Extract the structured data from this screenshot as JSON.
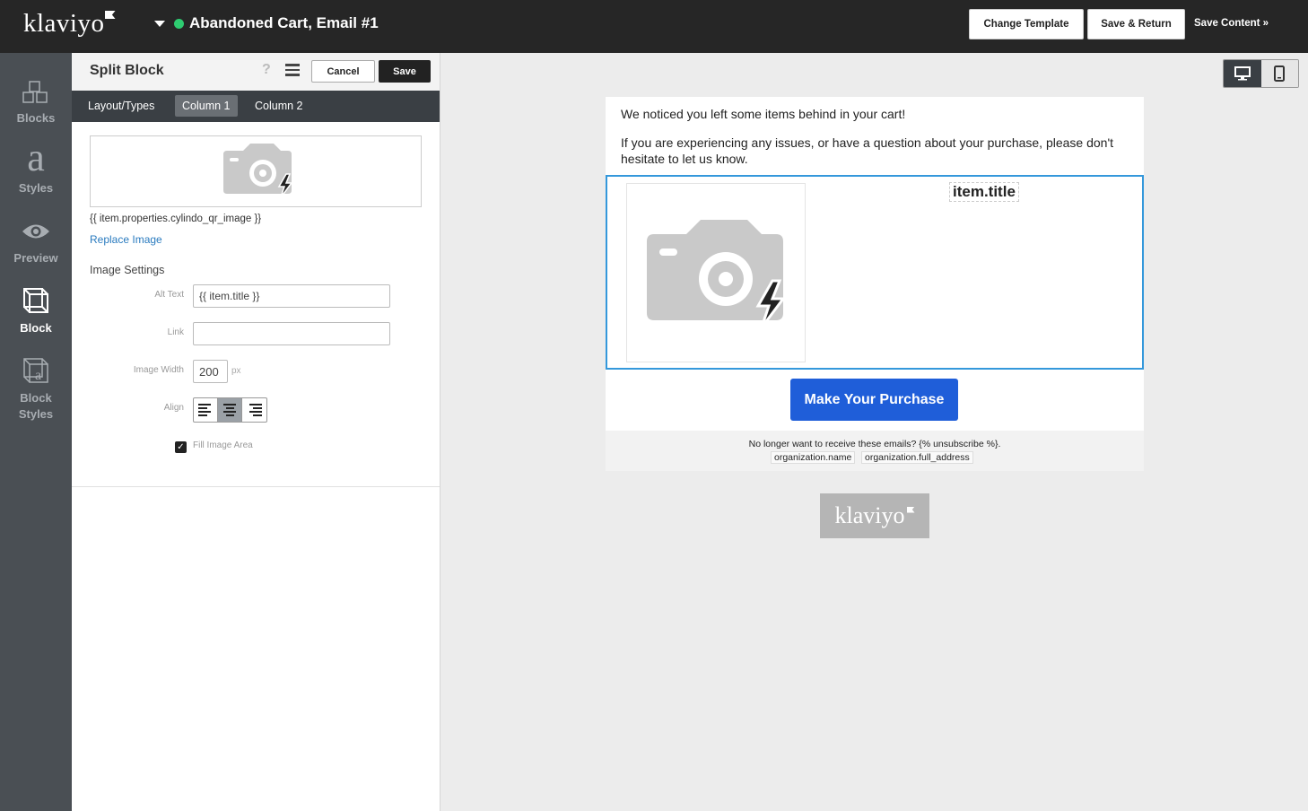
{
  "topbar": {
    "logo": "klaviyo",
    "flow_title": "Abandoned Cart, Email #1",
    "status_color": "#2ecc71",
    "change_template": "Change Template",
    "save_return": "Save & Return",
    "save_content": "Save Content »"
  },
  "rail": {
    "items": [
      {
        "label": "Blocks",
        "icon": "blocks-icon"
      },
      {
        "label": "Styles",
        "icon": "styles-icon"
      },
      {
        "label": "Preview",
        "icon": "eye-icon"
      },
      {
        "label": "Block",
        "icon": "cube-icon",
        "active": true
      },
      {
        "label": "Block",
        "label2": "Styles",
        "icon": "block-styles-icon"
      }
    ]
  },
  "panel": {
    "title": "Split Block",
    "help": "?",
    "cancel": "Cancel",
    "save": "Save",
    "tabs": [
      "Layout/Types",
      "Column 1",
      "Column 2"
    ],
    "active_tab": "Column 1",
    "image_caption": "{{ item.properties.cylindo_qr_image }}",
    "replace_image": "Replace Image",
    "section_title": "Image Settings",
    "alt_label": "Alt Text",
    "alt_value": "{{ item.title }}",
    "link_label": "Link",
    "link_value": "",
    "width_label": "Image Width",
    "width_value": "200",
    "width_unit": "px",
    "align_label": "Align",
    "align_selected": "center",
    "fill_label": "Fill Image Area",
    "fill_checked": true
  },
  "email": {
    "intro_1": "We noticed you left some items behind in your cart!",
    "intro_2": "If you are experiencing any issues, or have a question about your purchase, please don't hesitate to let us know.",
    "item_title": "item.title",
    "cta": "Make Your Purchase",
    "cta_color": "#1f5ed9",
    "unsubscribe": "No longer want to receive these emails? {% unsubscribe %}.",
    "org_name": "organization.name",
    "org_address": "organization.full_address",
    "badge": "klaviyo",
    "selection_color": "#3498db"
  }
}
